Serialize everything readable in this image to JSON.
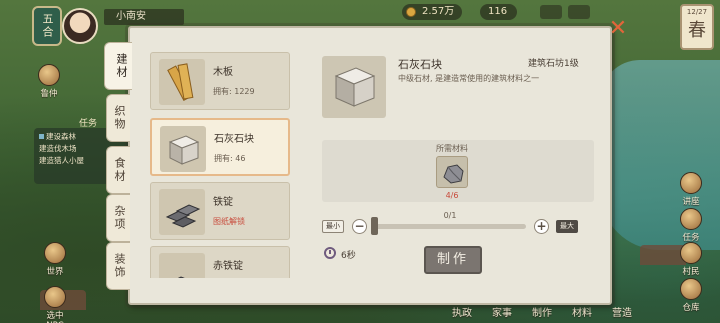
{
  "hud": {
    "level": "五合",
    "player_name": "小南安",
    "currency": "2.57万",
    "energy": "116",
    "season_date": "12/27",
    "season": "春"
  },
  "quests": {
    "title": "任务",
    "items": [
      "建设森林",
      "建造伐木场",
      "建造猎人小屋"
    ]
  },
  "side_buttons_left": [
    {
      "label": "鲁仲"
    },
    {
      "label": "世界"
    },
    {
      "label": "选中NPC"
    }
  ],
  "side_buttons_right": [
    {
      "label": "讲座"
    },
    {
      "label": "任务"
    },
    {
      "label": "村民"
    },
    {
      "label": "仓库"
    }
  ],
  "bottom_tabs": [
    "执政",
    "家事",
    "制作",
    "材料",
    "营造"
  ],
  "crafting": {
    "tabs": [
      {
        "label": "建材",
        "active": true
      },
      {
        "label": "织物",
        "active": false
      },
      {
        "label": "食材",
        "active": false
      },
      {
        "label": "杂项",
        "active": false
      },
      {
        "label": "装饰",
        "active": false
      }
    ],
    "items": [
      {
        "name": "木板",
        "sub": "拥有: 1229",
        "icon": "wood-plank-icon",
        "selected": false,
        "locked": false
      },
      {
        "name": "石灰石块",
        "sub": "拥有: 46",
        "icon": "limestone-block-icon",
        "selected": true,
        "locked": false
      },
      {
        "name": "铁锭",
        "sub": "图纸解锁",
        "icon": "iron-ingot-icon",
        "selected": false,
        "locked": true
      },
      {
        "name": "赤铁锭",
        "sub": "",
        "icon": "red-iron-ingot-icon",
        "selected": false,
        "locked": false
      }
    ],
    "detail": {
      "title": "石灰石块",
      "tag": "建筑石坊1级",
      "description": "中级石材, 是建造常使用的建筑材料之一",
      "materials_label": "所需材料",
      "material_count": "4/6",
      "material_icon": "stone-ore-icon"
    },
    "quantity": "0/1",
    "quantity_fraction": 0,
    "min_label": "最小",
    "max_label": "最大",
    "time": "6秒",
    "make_label": "制作"
  },
  "colors": {
    "panel_bg": "#e9e6da",
    "accent_red": "#c84b3c",
    "selected_border": "#e6b98a",
    "close": "#e2653a"
  }
}
